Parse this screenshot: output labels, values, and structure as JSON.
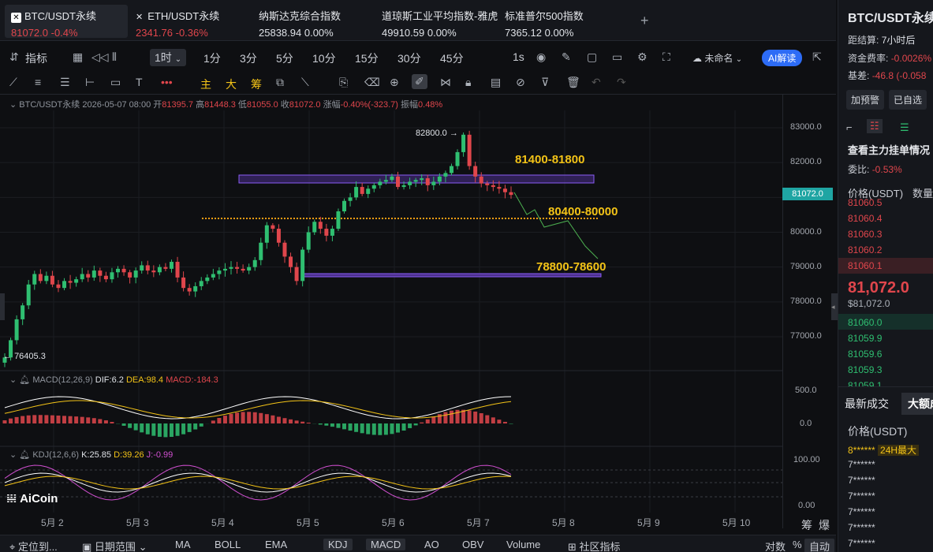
{
  "tickers": [
    {
      "name": "BTC/USDT永续",
      "price": "81072.0",
      "change": "-0.4%",
      "dir": "down"
    },
    {
      "name": "ETH/USDT永续",
      "price": "2341.76",
      "change": "-0.36%",
      "dir": "down"
    },
    {
      "name": "纳斯达克综合指数",
      "price": "25838.94",
      "change": "0.00%",
      "dir": "flat"
    },
    {
      "name": "道琼斯工业平均指数-雅虎",
      "price": "49910.59",
      "change": "0.00%",
      "dir": "flat"
    },
    {
      "name": "标准普尔500指数",
      "price": "7365.12",
      "change": "0.00%",
      "dir": "flat"
    }
  ],
  "toolbar": {
    "indicators": "指标",
    "interval": "1时",
    "intervals": [
      "1分",
      "3分",
      "5分",
      "10分",
      "15分",
      "30分",
      "45分"
    ],
    "seconds": "1s",
    "account": "未命名",
    "ai": "AI解读"
  },
  "drawtools": [
    "主",
    "大",
    "筹"
  ],
  "ohlc": {
    "symbol": "BTC/USDT永续",
    "time": "2026-05-07 08:00",
    "open_l": "开",
    "open": "81395.7",
    "high_l": "高",
    "high": "81448.3",
    "low_l": "低",
    "low": "81055.0",
    "close_l": "收",
    "close": "81072.0",
    "chg_l": "涨幅",
    "chg": "-0.40%(-323.7)",
    "amp_l": "振幅",
    "amp": "0.48%"
  },
  "chart_data": {
    "type": "candlestick",
    "y_ticks": [
      "83000.0",
      "82000.0",
      "81000.0",
      "80000.0",
      "79000.0",
      "78000.0",
      "77000.0"
    ],
    "last_price": "81072.0",
    "x_ticks": [
      "5月 2",
      "5月 3",
      "5月 4",
      "5月 5",
      "5月 6",
      "5月 7",
      "5月 8",
      "5月 9",
      "5月 10"
    ],
    "high_label": "82800.0",
    "low_label": "76405.3",
    "zones": [
      "81400-81800",
      "80400-80000",
      "78800-78600"
    ],
    "closes": [
      76405,
      76900,
      77500,
      77900,
      78500,
      78800,
      78600,
      78750,
      78500,
      78400,
      78600,
      78550,
      78650,
      78800,
      78700,
      78900,
      78750,
      78650,
      78850,
      78950,
      78850,
      78700,
      78900,
      79050,
      78900,
      78850,
      79000,
      78950,
      79150,
      78700,
      78400,
      78300,
      78450,
      78600,
      78700,
      78800,
      78900,
      78950,
      79000,
      78950,
      78900,
      79000,
      79200,
      79700,
      80200,
      80100,
      79700,
      79300,
      79000,
      78600,
      79500,
      80000,
      80300,
      80100,
      79900,
      80100,
      80600,
      80900,
      81000,
      81300,
      81100,
      81250,
      81350,
      81450,
      81500,
      81600,
      81300,
      81350,
      81450,
      81500,
      81550,
      81350,
      81450,
      81600,
      81700,
      81900,
      82300,
      82800,
      81900,
      81600,
      81400,
      81350,
      81300,
      81250,
      81150,
      81072
    ],
    "macd": {
      "params": "MACD(12,26,9)",
      "dif": "DIF:6.2",
      "dea": "DEA:98.4",
      "macd": "MACD:-184.3",
      "ticks": [
        "500.0",
        "0.0"
      ]
    },
    "kdj": {
      "params": "KDJ(12,6,6)",
      "k": "K:25.85",
      "d": "D:39.26",
      "j": "J:-0.99",
      "ticks": [
        "100.00",
        "0.00"
      ]
    }
  },
  "bottombar": {
    "locate": "定位到...",
    "range": "日期范围",
    "indicators": [
      "MA",
      "BOLL",
      "EMA",
      "KDJ",
      "MACD",
      "AO",
      "OBV",
      "Volume"
    ],
    "community": "社区指标",
    "log": "对数",
    "pct": "%",
    "auto": "自动",
    "side": [
      "筹",
      "爆"
    ],
    "logo": "AiCoin"
  },
  "right": {
    "title": "BTC/USDT永续",
    "settle_l": "距结算:",
    "settle": "7小时后",
    "fund_l": "资金费率:",
    "fund": "-0.0026%",
    "basis_l": "基差:",
    "basis": "-46.8 (-0.058",
    "alert": "加预警",
    "fav": "已自选",
    "book_title": "查看主力挂单情况",
    "ratio_l": "委比:",
    "ratio": "-0.53%",
    "price_h": "价格(USDT)",
    "qty_h": "数量",
    "asks": [
      "81060.5",
      "81060.4",
      "81060.3",
      "81060.2",
      "81060.1"
    ],
    "mid": "81,072.0",
    "mid_sub": "$81,072.0",
    "bids": [
      "81060.0",
      "81059.9",
      "81059.6",
      "81059.3",
      "81059.1"
    ],
    "trades_tab": "最新成交",
    "big_tab": "大额成",
    "trades_h": "价格(USDT)",
    "max24": "24H最大",
    "trades": [
      "8******",
      "7******",
      "7******",
      "7******",
      "7******",
      "7******",
      "7******"
    ]
  }
}
